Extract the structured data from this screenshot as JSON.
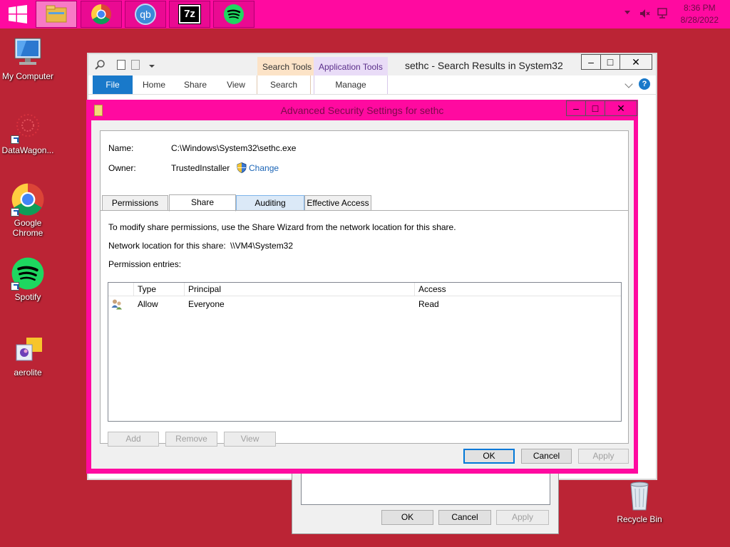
{
  "taskbar": {
    "apps": [
      {
        "name": "file-explorer"
      },
      {
        "name": "google-chrome"
      },
      {
        "name": "qbittorrent",
        "label": "qb"
      },
      {
        "name": "7-zip",
        "label": "7z"
      },
      {
        "name": "spotify"
      }
    ],
    "clock": {
      "time": "8:36 PM",
      "date": "8/28/2022"
    },
    "colors": {
      "bar": "#ff0aa0",
      "desktop": "#bb2435"
    }
  },
  "desktop": {
    "icons": [
      {
        "label": "My Computer"
      },
      {
        "label": "DataWagon..."
      },
      {
        "label": "Google Chrome"
      },
      {
        "label": "Spotify"
      },
      {
        "label": "aerolite"
      },
      {
        "label": "Recycle Bin"
      }
    ]
  },
  "explorer": {
    "title": "sethc - Search Results in System32",
    "context_tabs": [
      "Search Tools",
      "Application Tools"
    ],
    "ribbon_tabs": [
      "File",
      "Home",
      "Share",
      "View",
      "Search",
      "Manage"
    ]
  },
  "dialog": {
    "title": "Advanced Security Settings for sethc",
    "name_label": "Name:",
    "name_value": "C:\\Windows\\System32\\sethc.exe",
    "owner_label": "Owner:",
    "owner_value": "TrustedInstaller",
    "change_link": "Change",
    "tabs": [
      "Permissions",
      "Share",
      "Auditing",
      "Effective Access"
    ],
    "info_text": "To modify share permissions, use the Share Wizard from the network location for this share.",
    "network_label": "Network location for this share:",
    "network_value": "\\\\VM4\\System32",
    "entries_label": "Permission entries:",
    "columns": [
      "Type",
      "Principal",
      "Access"
    ],
    "rows": [
      {
        "type": "Allow",
        "principal": "Everyone",
        "access": "Read"
      }
    ],
    "add_button": "Add",
    "remove_button": "Remove",
    "view_button": "View",
    "ok_button": "OK",
    "cancel_button": "Cancel",
    "apply_button": "Apply"
  },
  "dialog2": {
    "ok_button": "OK",
    "cancel_button": "Cancel",
    "apply_button": "Apply"
  }
}
